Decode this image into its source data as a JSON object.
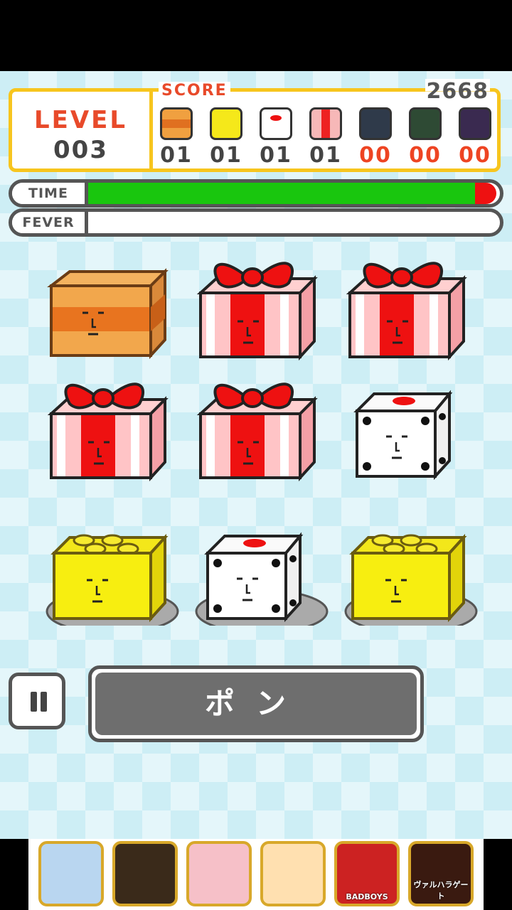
{
  "hud": {
    "level_label": "LEVEL",
    "level_value": "003",
    "score_label": "SCORE",
    "score_value": "2668",
    "counters": [
      {
        "name": "cardboard-box",
        "count": "01",
        "color": "#f0a040",
        "count_color": "#444444"
      },
      {
        "name": "yellow-block",
        "count": "01",
        "color": "#f5e81a",
        "count_color": "#444444"
      },
      {
        "name": "white-dice",
        "count": "01",
        "color": "#ffffff",
        "count_color": "#444444"
      },
      {
        "name": "gift-box",
        "count": "01",
        "color": "#f7b8b8",
        "count_color": "#444444"
      },
      {
        "name": "navy-box",
        "count": "00",
        "color": "#2f3a4a",
        "count_color": "#ee4422"
      },
      {
        "name": "green-box",
        "count": "00",
        "color": "#2e4a34",
        "count_color": "#ee4422"
      },
      {
        "name": "purple-box",
        "count": "00",
        "color": "#3a2a50",
        "count_color": "#ee4422"
      }
    ]
  },
  "bars": {
    "time_label": "TIME",
    "time_remaining": 0.97,
    "fever_label": "FEVER",
    "fever_level": 0
  },
  "grid": [
    [
      "cardboard-box",
      "gift-box",
      "gift-box"
    ],
    [
      "gift-box",
      "gift-box",
      "white-dice"
    ],
    [
      "yellow-block",
      "white-dice",
      "yellow-block"
    ]
  ],
  "controls": {
    "pon_label": "ポン"
  },
  "ads": [
    "app-ad-1",
    "app-ad-2",
    "app-ad-3",
    "app-ad-4",
    "BADBOYS",
    "ヴァルハラゲート"
  ],
  "colors": {
    "accent": "#f7c51e",
    "level_red": "#e84a2a",
    "time_green": "#19c60e",
    "time_red": "#ee1111"
  }
}
